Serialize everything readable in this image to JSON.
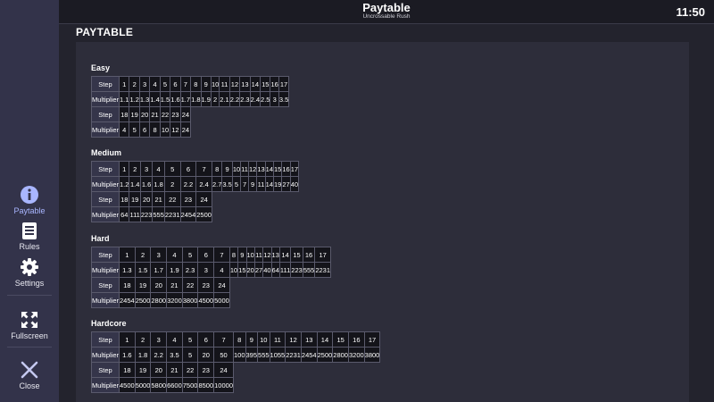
{
  "header": {
    "title": "Paytable",
    "subtitle": "Uncrossable Rush",
    "clock": "11:50"
  },
  "page_title": "PAYTABLE",
  "row_labels": {
    "step": "Step",
    "multiplier": "Multiplier"
  },
  "sidebar": {
    "paytable": "Paytable",
    "rules": "Rules",
    "settings": "Settings",
    "fullscreen": "Fullscreen",
    "close": "Close"
  },
  "sections": [
    {
      "name": "Easy",
      "steps1": [
        "1",
        "2",
        "3",
        "4",
        "5",
        "6",
        "7",
        "8",
        "9",
        "10",
        "11",
        "12",
        "13",
        "14",
        "15",
        "16",
        "17"
      ],
      "mult1": [
        "1.1",
        "1.2",
        "1.3",
        "1.4",
        "1.5",
        "1.6",
        "1.7",
        "1.8",
        "1.9",
        "2",
        "2.1",
        "2.2",
        "2.3",
        "2.4",
        "2.5",
        "3",
        "3.5"
      ],
      "steps2": [
        "18",
        "19",
        "20",
        "21",
        "22",
        "23",
        "24"
      ],
      "mult2": [
        "4",
        "5",
        "6",
        "8",
        "10",
        "12",
        "24"
      ]
    },
    {
      "name": "Medium",
      "steps1": [
        "1",
        "2",
        "3",
        "4",
        "5",
        "6",
        "7",
        "8",
        "9",
        "10",
        "11",
        "12",
        "13",
        "14",
        "15",
        "16",
        "17"
      ],
      "mult1": [
        "1.2",
        "1.4",
        "1.6",
        "1.8",
        "2",
        "2.2",
        "2.4",
        "2.7",
        "3.5",
        "5",
        "7",
        "9",
        "11",
        "14",
        "19",
        "27",
        "40"
      ],
      "steps2": [
        "18",
        "19",
        "20",
        "21",
        "22",
        "23",
        "24"
      ],
      "mult2": [
        "64",
        "111",
        "223",
        "555",
        "2231",
        "2454",
        "2500"
      ]
    },
    {
      "name": "Hard",
      "steps1": [
        "1",
        "2",
        "3",
        "4",
        "5",
        "6",
        "7",
        "8",
        "9",
        "10",
        "11",
        "12",
        "13",
        "14",
        "15",
        "16",
        "17"
      ],
      "mult1": [
        "1.3",
        "1.5",
        "1.7",
        "1.9",
        "2.3",
        "3",
        "4",
        "10",
        "15",
        "20",
        "27",
        "40",
        "64",
        "111",
        "223",
        "555",
        "2231"
      ],
      "steps2": [
        "18",
        "19",
        "20",
        "21",
        "22",
        "23",
        "24"
      ],
      "mult2": [
        "2454",
        "2500",
        "2800",
        "3200",
        "3800",
        "4500",
        "5000"
      ]
    },
    {
      "name": "Hardcore",
      "steps1": [
        "1",
        "2",
        "3",
        "4",
        "5",
        "6",
        "7",
        "8",
        "9",
        "10",
        "11",
        "12",
        "13",
        "14",
        "15",
        "16",
        "17"
      ],
      "mult1": [
        "1.6",
        "1.8",
        "2.2",
        "3.5",
        "5",
        "20",
        "50",
        "100",
        "395",
        "555",
        "1055",
        "2231",
        "2454",
        "2500",
        "2800",
        "3200",
        "3800"
      ],
      "steps2": [
        "18",
        "19",
        "20",
        "21",
        "22",
        "23",
        "24"
      ],
      "mult2": [
        "4500",
        "5000",
        "5800",
        "6600",
        "7500",
        "8500",
        "10000"
      ]
    }
  ]
}
